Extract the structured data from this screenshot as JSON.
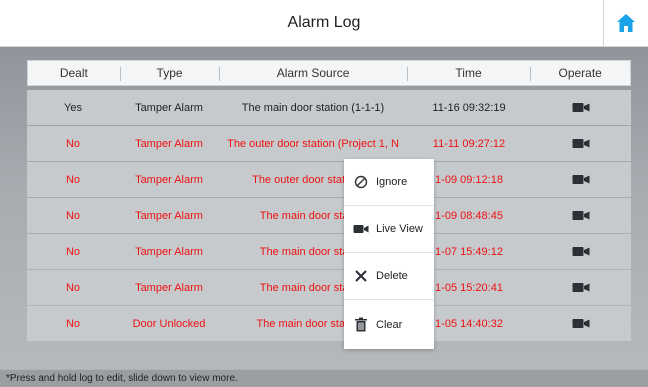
{
  "header": {
    "title": "Alarm Log",
    "home_icon": "home-icon"
  },
  "columns": [
    "Dealt",
    "Type",
    "Alarm Source",
    "Time",
    "Operate"
  ],
  "rows": [
    {
      "dealt": "Yes",
      "type": "Tamper Alarm",
      "source": "The main door station (1-1-1)",
      "time": "11-16 09:32:19",
      "status": "dealt"
    },
    {
      "dealt": "No",
      "type": "Tamper Alarm",
      "source": "The outer door station (Project 1, N",
      "time": "11-11 09:27:12",
      "status": "undealt"
    },
    {
      "dealt": "No",
      "type": "Tamper Alarm",
      "source": "The outer door station (P",
      "time": "1-09 09:12:18",
      "status": "undealt"
    },
    {
      "dealt": "No",
      "type": "Tamper Alarm",
      "source": "The main door station",
      "time": "1-09 08:48:45",
      "status": "undealt"
    },
    {
      "dealt": "No",
      "type": "Tamper Alarm",
      "source": "The main door station",
      "time": "1-07 15:49:12",
      "status": "undealt"
    },
    {
      "dealt": "No",
      "type": "Tamper Alarm",
      "source": "The main door station",
      "time": "1-05 15:20:41",
      "status": "undealt"
    },
    {
      "dealt": "No",
      "type": "Door Unlocked",
      "source": "The main door station (",
      "time": "1-05 14:40:32",
      "status": "undealt"
    }
  ],
  "context_menu": {
    "items": [
      {
        "label": "Ignore",
        "icon": "ignore-icon"
      },
      {
        "label": "Live View",
        "icon": "camera-icon"
      },
      {
        "label": "Delete",
        "icon": "delete-x-icon"
      },
      {
        "label": "Clear",
        "icon": "trash-icon"
      }
    ]
  },
  "footer": {
    "hint": "*Press and hold log to edit, slide down to view more."
  },
  "colors": {
    "undealt": "#ee1111",
    "dealt": "#222222",
    "home_icon": "#1aa3e8"
  }
}
